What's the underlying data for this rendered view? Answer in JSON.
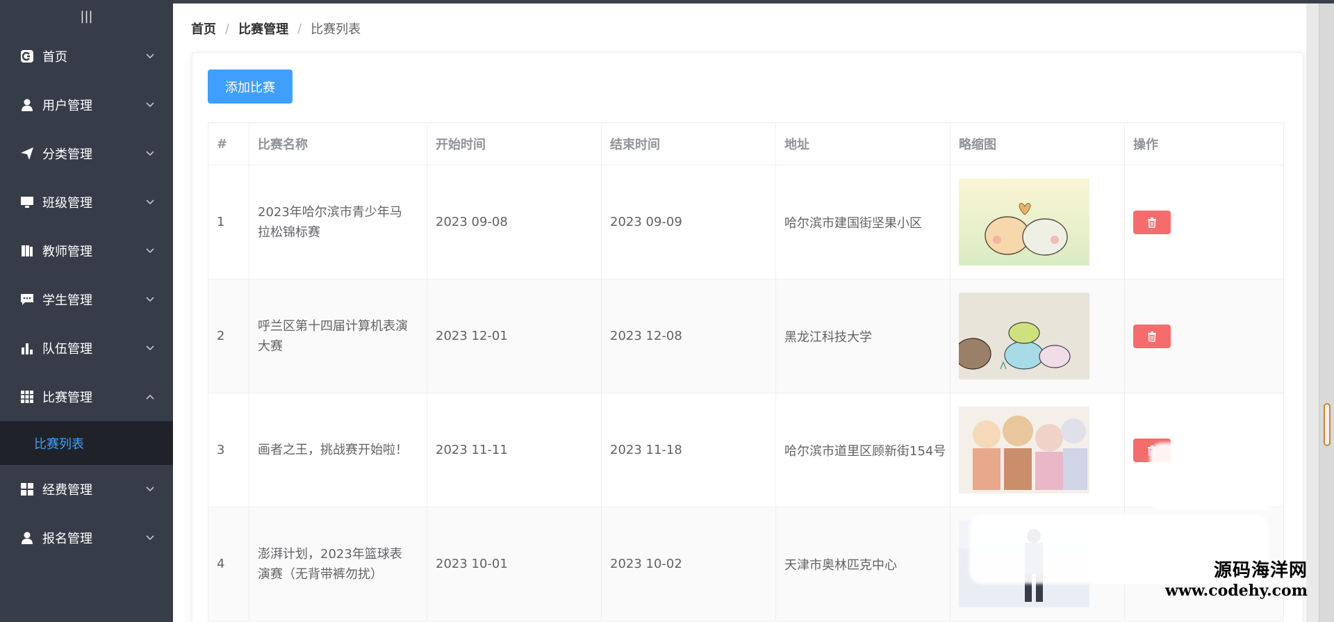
{
  "sidebar": {
    "collapse_icon": "|||",
    "items": [
      {
        "label": "首页",
        "icon": "dashboard-icon"
      },
      {
        "label": "用户管理",
        "icon": "user-icon"
      },
      {
        "label": "分类管理",
        "icon": "paper-plane-icon"
      },
      {
        "label": "班级管理",
        "icon": "monitor-icon"
      },
      {
        "label": "教师管理",
        "icon": "book-icon"
      },
      {
        "label": "学生管理",
        "icon": "chat-icon"
      },
      {
        "label": "队伍管理",
        "icon": "bar-chart-icon"
      },
      {
        "label": "比赛管理",
        "icon": "grid-icon",
        "open": true
      },
      {
        "label": "经费管理",
        "icon": "apps-icon"
      },
      {
        "label": "报名管理",
        "icon": "user-icon"
      }
    ],
    "submenu_active": "比赛列表"
  },
  "breadcrumb": {
    "home": "首页",
    "parent": "比赛管理",
    "current": "比赛列表",
    "separator": "/"
  },
  "toolbar": {
    "add_label": "添加比赛"
  },
  "table": {
    "headers": [
      "#",
      "比赛名称",
      "开始时间",
      "结束时间",
      "地址",
      "略缩图",
      "操作"
    ],
    "rows": [
      {
        "index": "1",
        "name": "2023年哈尔滨市青少年马拉松锦标赛",
        "start": "2023 09-08",
        "end": "2023 09-09",
        "address": "哈尔滨市建国街坚果小区",
        "thumb": "dango-heart"
      },
      {
        "index": "2",
        "name": "呼兰区第十四届计算机表演大赛",
        "start": "2023 12-01",
        "end": "2023 12-08",
        "address": "黑龙江科技大学",
        "thumb": "dango-stack"
      },
      {
        "index": "3",
        "name": "画者之王，挑战赛开始啦！",
        "start": "2023 11-11",
        "end": "2023 11-18",
        "address": "哈尔滨市道里区顾新街154号",
        "thumb": "anime-group"
      },
      {
        "index": "4",
        "name": "澎湃计划，2023年篮球表演赛（无背带裤勿扰）",
        "start": "2023 10-01",
        "end": "2023 10-02",
        "address": "天津市奥林匹克中心",
        "thumb": "stage-photo"
      }
    ]
  },
  "watermark": {
    "cn": "源码海洋网",
    "url": "www.codehy.com"
  },
  "colors": {
    "sidebar_bg": "#363d48",
    "submenu_bg": "#1f2329",
    "primary": "#409eff",
    "danger": "#f56c6c"
  }
}
